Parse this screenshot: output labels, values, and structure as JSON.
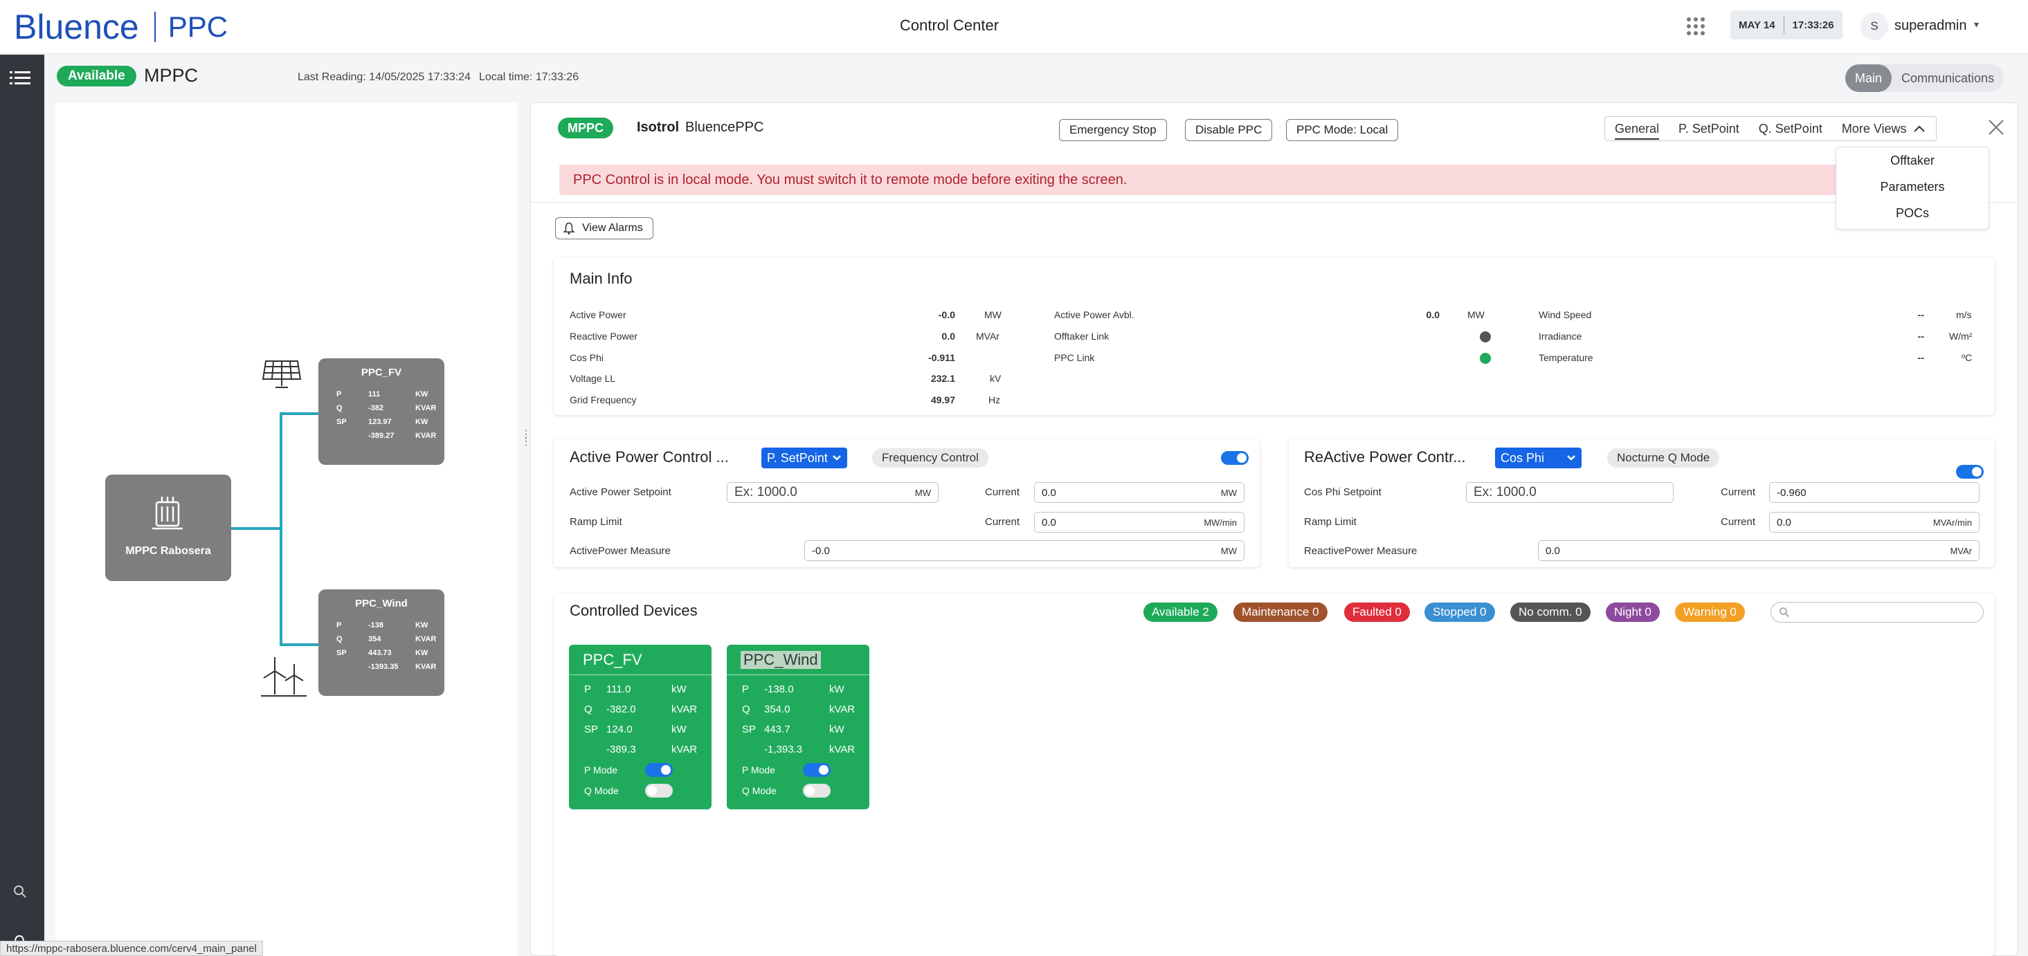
{
  "header": {
    "brand_main": "Bluence",
    "brand_sub": "PPC",
    "title": "Control Center",
    "date": "MAY 14",
    "time": "17:33:26",
    "avatar_initial": "S",
    "username": "superadmin"
  },
  "subheader": {
    "status": "Available",
    "site": "MPPC",
    "last_reading": "Last Reading: 14/05/2025 17:33:24",
    "local_time": "Local time: 17:33:26",
    "views": [
      "Main",
      "Communications"
    ]
  },
  "diagram": {
    "root_label": "MPPC Rabosera",
    "nodes": [
      {
        "title": "PPC_FV",
        "rows": [
          {
            "k": "P",
            "v": "111",
            "u": "KW"
          },
          {
            "k": "Q",
            "v": "-382",
            "u": "KVAR"
          },
          {
            "k": "SP",
            "v": "123.97",
            "u": "KW"
          },
          {
            "k": "",
            "v": "-389.27",
            "u": "KVAR"
          }
        ]
      },
      {
        "title": "PPC_Wind",
        "rows": [
          {
            "k": "P",
            "v": "-138",
            "u": "KW"
          },
          {
            "k": "Q",
            "v": "354",
            "u": "KVAR"
          },
          {
            "k": "SP",
            "v": "443.73",
            "u": "KW"
          },
          {
            "k": "",
            "v": "-1393.35",
            "u": "KVAR"
          }
        ]
      }
    ]
  },
  "panel": {
    "pill": "MPPC",
    "vendor": "Isotrol",
    "model": "BluencePPC",
    "btn_estop": "Emergency Stop",
    "btn_disable": "Disable PPC",
    "btn_mode": "PPC Mode: Local",
    "tabs": [
      "General",
      "P. SetPoint",
      "Q. SetPoint",
      "More Views"
    ],
    "more_menu": [
      "Offtaker",
      "Parameters",
      "POCs"
    ],
    "alert": "PPC Control is in local mode. You must switch it to remote mode before exiting the screen.",
    "view_alarms": "View Alarms"
  },
  "main_info": {
    "title": "Main Info",
    "col1": [
      {
        "label": "Active Power",
        "value": "-0.0",
        "unit": "MW"
      },
      {
        "label": "Reactive Power",
        "value": "0.0",
        "unit": "MVAr"
      },
      {
        "label": "Cos Phi",
        "value": "-0.911",
        "unit": ""
      },
      {
        "label": "Voltage LL",
        "value": "232.1",
        "unit": "kV"
      },
      {
        "label": "Grid Frequency",
        "value": "49.97",
        "unit": "Hz"
      }
    ],
    "col2": [
      {
        "label": "Active Power Avbl.",
        "value": "0.0",
        "unit": "MW"
      },
      {
        "label": "Offtaker Link",
        "status_color": "#555555"
      },
      {
        "label": "PPC Link",
        "status_color": "#1eaa59"
      }
    ],
    "col3": [
      {
        "label": "Wind Speed",
        "value": "--",
        "unit": "m/s"
      },
      {
        "label": "Irradiance",
        "value": "--",
        "unit": "W/m²"
      },
      {
        "label": "Temperature",
        "value": "--",
        "unit": "ºC"
      }
    ]
  },
  "active_power": {
    "title": "Active Power Control ...",
    "select": "P. SetPoint",
    "chip": "Frequency Control",
    "setpoint_label": "Active Power Setpoint",
    "setpoint_placeholder": "Ex: 1000.0",
    "setpoint_unit": "MW",
    "current_label": "Current",
    "current_value": "0.0",
    "current_unit": "MW",
    "ramp_label": "Ramp Limit",
    "ramp_current_label": "Current",
    "ramp_value": "0.0",
    "ramp_unit": "MW/min",
    "measure_label": "ActivePower Measure",
    "measure_value": "-0.0",
    "measure_unit": "MW"
  },
  "reactive_power": {
    "title": "ReActive Power Contr...",
    "select": "Cos Phi",
    "chip": "Nocturne Q Mode",
    "setpoint_label": "Cos Phi Setpoint",
    "setpoint_placeholder": "Ex: 1000.0",
    "current_label": "Current",
    "current_value": "-0.960",
    "ramp_label": "Ramp Limit",
    "ramp_current_label": "Current",
    "ramp_value": "0.0",
    "ramp_unit": "MVAr/min",
    "measure_label": "ReactivePower Measure",
    "measure_value": "0.0",
    "measure_unit": "MVAr"
  },
  "devices": {
    "title": "Controlled Devices",
    "badges": [
      {
        "label": "Available 2",
        "color": "#1eaa59"
      },
      {
        "label": "Maintenance 0",
        "color": "#a0522d"
      },
      {
        "label": "Faulted 0",
        "color": "#e02e3c"
      },
      {
        "label": "Stopped 0",
        "color": "#3a8fd0"
      },
      {
        "label": "No comm. 0",
        "color": "#555555"
      },
      {
        "label": "Night 0",
        "color": "#8e4a9e"
      },
      {
        "label": "Warning 0",
        "color": "#f2a024"
      }
    ],
    "tiles": [
      {
        "name": "PPC_FV",
        "rows": [
          {
            "k": "P",
            "v": "111.0",
            "u": "kW"
          },
          {
            "k": "Q",
            "v": "-382.0",
            "u": "kVAR"
          },
          {
            "k": "SP",
            "v": "124.0",
            "u": "kW"
          },
          {
            "k": "",
            "v": "-389.3",
            "u": "kVAR"
          }
        ],
        "p_mode": "P Mode",
        "q_mode": "Q Mode"
      },
      {
        "name": "PPC_Wind",
        "rows": [
          {
            "k": "P",
            "v": "-138.0",
            "u": "kW"
          },
          {
            "k": "Q",
            "v": "354.0",
            "u": "kVAR"
          },
          {
            "k": "SP",
            "v": "443.7",
            "u": "kW"
          },
          {
            "k": "",
            "v": "-1,393.3",
            "u": "kVAR"
          }
        ],
        "p_mode": "P Mode",
        "q_mode": "Q Mode"
      }
    ]
  },
  "status_url": "https://mppc-rabosera.bluence.com/cerv4_main_panel"
}
